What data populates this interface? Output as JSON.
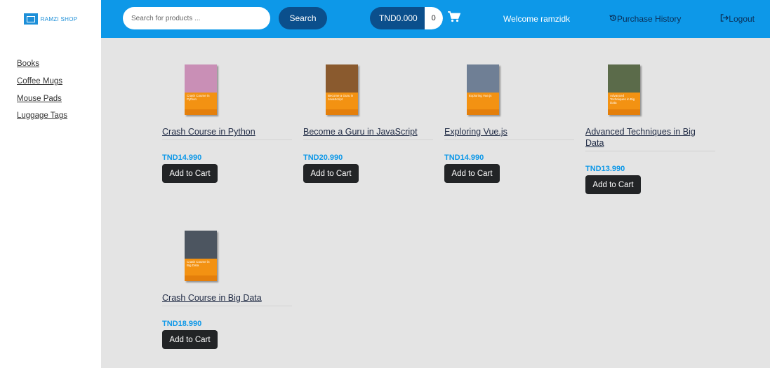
{
  "brand": {
    "logo_text": "RAMZI SHOP"
  },
  "header": {
    "search_placeholder": "Search for products ...",
    "search_label": "Search",
    "cart_total": "TND0.000",
    "cart_count": "0",
    "welcome": "Welcome ramzidk",
    "purchase_history": "Purchase History",
    "logout": "Logout"
  },
  "sidebar": {
    "items": [
      {
        "label": "Books"
      },
      {
        "label": "Coffee Mugs"
      },
      {
        "label": "Mouse Pads"
      },
      {
        "label": "Luggage Tags"
      }
    ]
  },
  "products": [
    {
      "title": "Crash Course in Python",
      "price": "TND14.990",
      "cover_text": "Crash Course in Python",
      "photo_color": "#c98fb6",
      "add_label": "Add to Cart"
    },
    {
      "title": "Become a Guru in JavaScript",
      "price": "TND20.990",
      "cover_text": "Become a Guru in JavaScript",
      "photo_color": "#8a5a2e",
      "add_label": "Add to Cart"
    },
    {
      "title": "Exploring Vue.js",
      "price": "TND14.990",
      "cover_text": "Exploring Vue.js",
      "photo_color": "#6f7f95",
      "add_label": "Add to Cart"
    },
    {
      "title": "Advanced Techniques in Big Data",
      "price": "TND13.990",
      "cover_text": "Advanced Techniques in Big Data",
      "photo_color": "#5b6b4a",
      "add_label": "Add to Cart"
    },
    {
      "title": "Crash Course in Big Data",
      "price": "TND18.990",
      "cover_text": "Crash Course in Big Data",
      "photo_color": "#4c5560",
      "add_label": "Add to Cart"
    }
  ],
  "colors": {
    "header_blue": "#0d98e8",
    "button_navy": "#0b4f8c",
    "price_blue": "#0d98e8",
    "cover_orange": "#f39212"
  },
  "icons": [
    "cart-icon",
    "history-icon",
    "logout-icon"
  ]
}
